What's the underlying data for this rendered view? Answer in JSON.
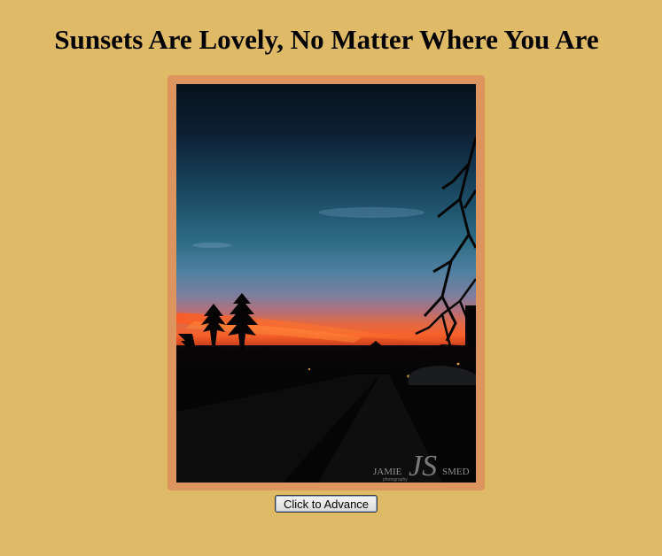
{
  "page": {
    "title": "Sunsets Are Lovely, No Matter Where You Are",
    "background_color": "#dfba67",
    "frame_color": "#dd9560"
  },
  "slideshow": {
    "photo": {
      "description_icon": "sunset-photo",
      "watermark_left": "JAMIE",
      "watermark_monogram": "JS",
      "watermark_right": "SMED",
      "watermark_sub": "photography"
    },
    "advance_button_label": "Click to Advance"
  }
}
